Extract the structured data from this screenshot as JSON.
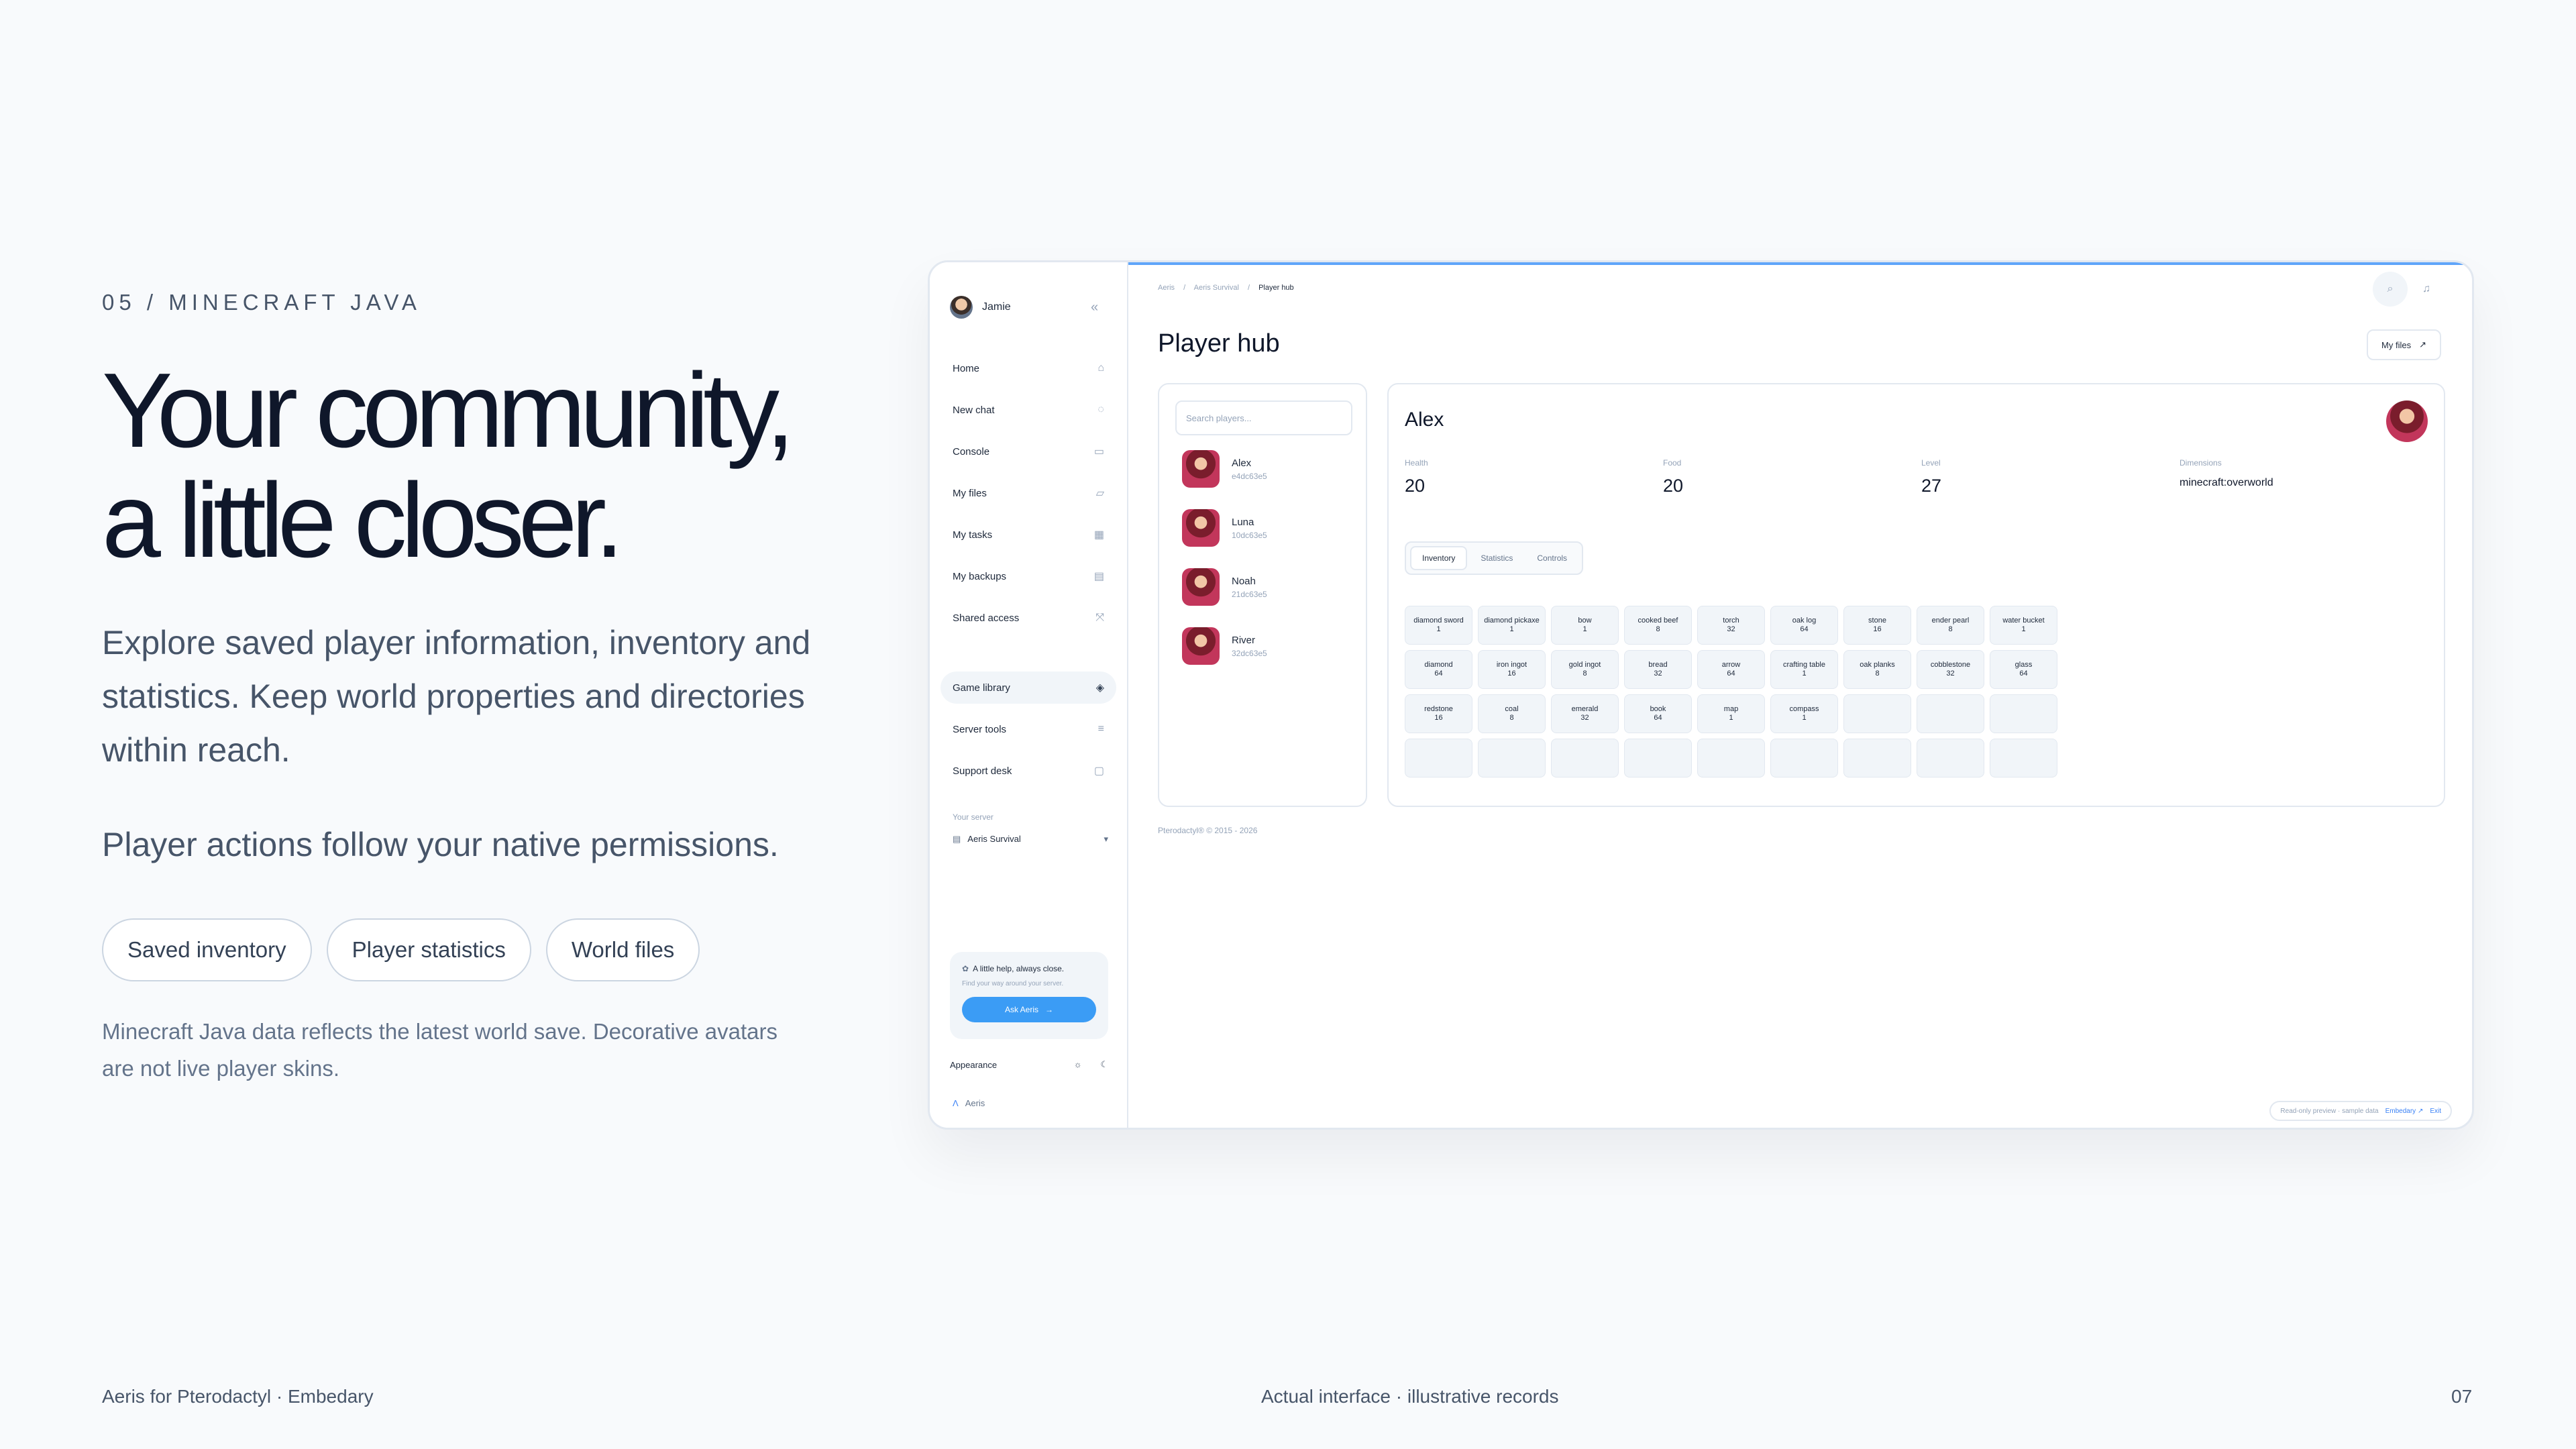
{
  "slide": {
    "eyebrow": "05 / MINECRAFT JAVA",
    "headline_line1": "Your community,",
    "headline_line2": "a little closer.",
    "lede": "Explore saved player information, inventory and statistics. Keep world properties and directories within reach.",
    "permissions": "Player actions follow your native permissions.",
    "chips": [
      "Saved inventory",
      "Player statistics",
      "World files"
    ],
    "note": "Minecraft Java data reflects the latest world save. Decorative avatars are not live player skins.",
    "footer_left": "Aeris for Pterodactyl · Embedary",
    "footer_center": "Actual interface · illustrative records",
    "footer_right": "07"
  },
  "app": {
    "user": "Jamie",
    "nav": [
      {
        "label": "Home",
        "icon": "home-icon"
      },
      {
        "label": "New chat",
        "icon": "chat-icon"
      },
      {
        "label": "Console",
        "icon": "terminal-icon"
      },
      {
        "label": "My files",
        "icon": "folder-icon"
      },
      {
        "label": "My tasks",
        "icon": "calendar-icon"
      },
      {
        "label": "My backups",
        "icon": "archive-icon"
      },
      {
        "label": "Shared access",
        "icon": "share-icon"
      },
      {
        "label": "Game library",
        "icon": "gamepad-icon"
      },
      {
        "label": "Server tools",
        "icon": "tools-icon"
      },
      {
        "label": "Support desk",
        "icon": "support-icon"
      }
    ],
    "active_nav": "Game library",
    "server_label": "Your server",
    "server_name": "Aeris Survival",
    "help_title": "A little help, always close.",
    "help_sub": "Find your way around your server.",
    "help_button": "Ask Aeris",
    "appearance": "Appearance",
    "brand": "Aeris",
    "breadcrumb": [
      "Aeris",
      "Aeris Survival",
      "Player hub"
    ],
    "page_title": "Player hub",
    "my_files_button": "My files",
    "search_placeholder": "Search players...",
    "players": [
      {
        "name": "Alex",
        "id": "e4dc63e5"
      },
      {
        "name": "Luna",
        "id": "10dc63e5"
      },
      {
        "name": "Noah",
        "id": "21dc63e5"
      },
      {
        "name": "River",
        "id": "32dc63e5"
      }
    ],
    "selected_player": "Alex",
    "stats": [
      {
        "label": "Health",
        "value": "20"
      },
      {
        "label": "Food",
        "value": "20"
      },
      {
        "label": "Level",
        "value": "27"
      },
      {
        "label": "Dimensions",
        "value": "minecraft:overworld"
      }
    ],
    "tabs": [
      "Inventory",
      "Statistics",
      "Controls"
    ],
    "active_tab": "Inventory",
    "inventory": [
      {
        "item": "diamond sword",
        "count": "1"
      },
      {
        "item": "diamond pickaxe",
        "count": "1"
      },
      {
        "item": "bow",
        "count": "1"
      },
      {
        "item": "cooked beef",
        "count": "8"
      },
      {
        "item": "torch",
        "count": "32"
      },
      {
        "item": "oak log",
        "count": "64"
      },
      {
        "item": "stone",
        "count": "16"
      },
      {
        "item": "ender pearl",
        "count": "8"
      },
      {
        "item": "water bucket",
        "count": "1"
      },
      {
        "item": "diamond",
        "count": "64"
      },
      {
        "item": "iron ingot",
        "count": "16"
      },
      {
        "item": "gold ingot",
        "count": "8"
      },
      {
        "item": "bread",
        "count": "32"
      },
      {
        "item": "arrow",
        "count": "64"
      },
      {
        "item": "crafting table",
        "count": "1"
      },
      {
        "item": "oak planks",
        "count": "8"
      },
      {
        "item": "cobblestone",
        "count": "32"
      },
      {
        "item": "glass",
        "count": "64"
      },
      {
        "item": "redstone",
        "count": "16"
      },
      {
        "item": "coal",
        "count": "8"
      },
      {
        "item": "emerald",
        "count": "32"
      },
      {
        "item": "book",
        "count": "64"
      },
      {
        "item": "map",
        "count": "1"
      },
      {
        "item": "compass",
        "count": "1"
      }
    ],
    "copyright": "Pterodactyl® © 2015 - 2026",
    "readonly_note": "Read-only preview · sample data",
    "readonly_brand": "Embedary ↗",
    "readonly_exit": "Exit"
  }
}
